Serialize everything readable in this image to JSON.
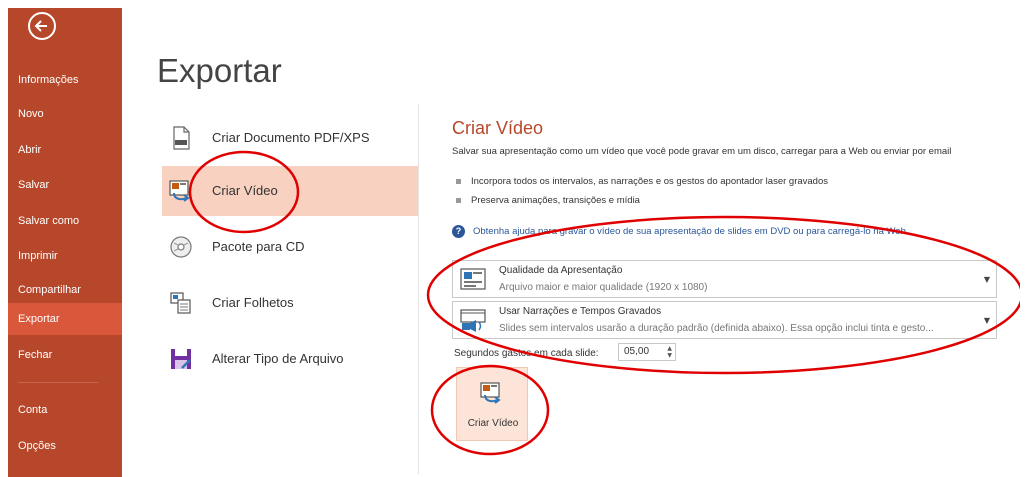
{
  "sidebar": {
    "back_icon": "back-arrow-icon",
    "items": [
      {
        "label": "Informações"
      },
      {
        "label": "Novo"
      },
      {
        "label": "Abrir"
      },
      {
        "label": "Salvar"
      },
      {
        "label": "Salvar como"
      },
      {
        "label": "Imprimir"
      },
      {
        "label": "Compartilhar"
      },
      {
        "label": "Exportar",
        "active": true
      },
      {
        "label": "Fechar"
      },
      {
        "label": "Conta"
      },
      {
        "label": "Opções"
      }
    ],
    "color": "#b7472a",
    "active_color": "#d9583b"
  },
  "page": {
    "title": "Exportar"
  },
  "export_options": [
    {
      "label": "Criar Documento PDF/XPS",
      "icon": "pdf-document-icon"
    },
    {
      "label": "Criar Vídeo",
      "icon": "video-slides-icon",
      "active": true
    },
    {
      "label": "Pacote para CD",
      "icon": "cd-icon"
    },
    {
      "label": "Criar Folhetos",
      "icon": "handouts-icon"
    },
    {
      "label": "Alterar Tipo de Arquivo",
      "icon": "save-as-icon"
    }
  ],
  "detail": {
    "title": "Criar Vídeo",
    "description": "Salvar sua apresentação como um vídeo que você pode gravar em um disco, carregar para a Web ou enviar por email",
    "bullets": [
      "Incorpora todos os intervalos, as narrações e os gestos do apontador laser gravados",
      "Preserva animações, transições e mídia"
    ],
    "help_link": "Obtenha ajuda para gravar o vídeo de sua apresentação de slides em DVD ou para carregá-lo na Web",
    "quality_dropdown": {
      "title": "Qualidade da Apresentação",
      "subtitle": "Arquivo maior e maior qualidade (1920 x 1080)",
      "icon": "presentation-quality-icon"
    },
    "narration_dropdown": {
      "title": "Usar Narrações e Tempos Gravados",
      "subtitle": "Slides sem intervalos usarão a duração padrão (definida abaixo). Essa opção inclui tinta e gesto...",
      "icon": "narration-timings-icon"
    },
    "seconds_label": "Segundos gastos em cada slide:",
    "seconds_value": "05,00",
    "create_button": {
      "label": "Criar Vídeo",
      "icon": "create-video-icon"
    }
  },
  "accent": "#b7472a",
  "annotation_color": "#e00000"
}
